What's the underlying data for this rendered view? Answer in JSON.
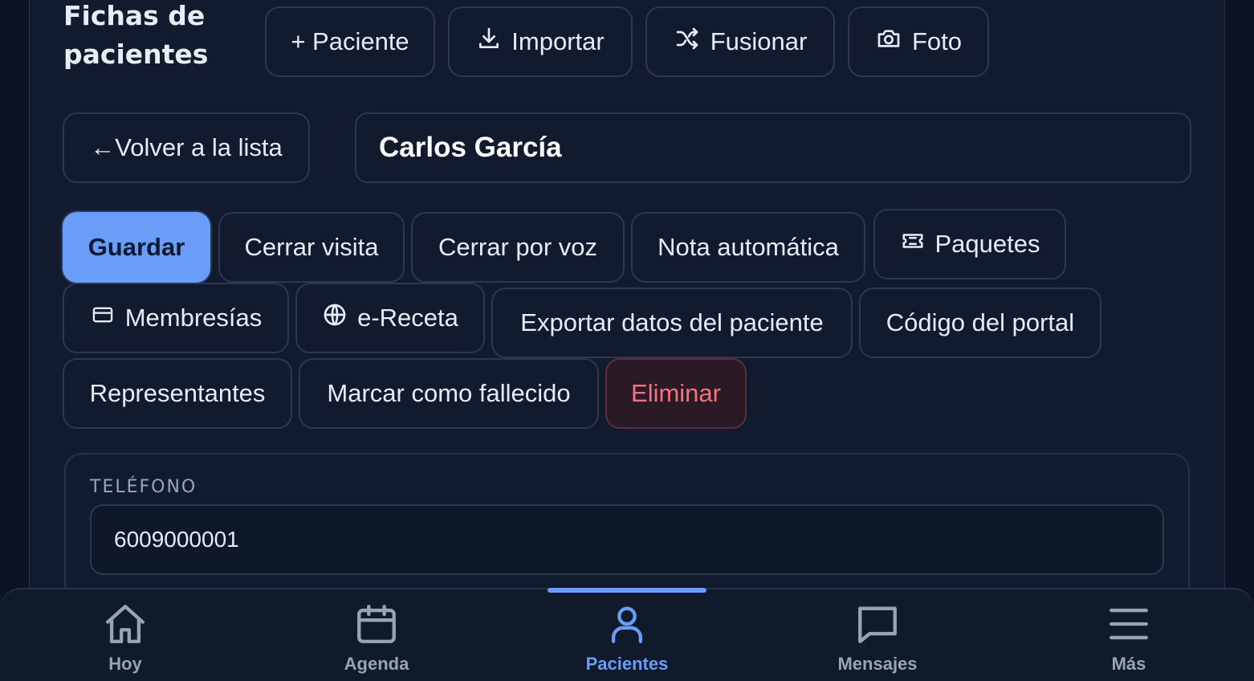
{
  "header": {
    "title": "Fichas de pacientes",
    "actions": {
      "add_patient": "+ Paciente",
      "import": "Importar",
      "merge": "Fusionar",
      "photo": "Foto"
    }
  },
  "patient": {
    "back_label": "←Volver a la lista",
    "name": "Carlos García"
  },
  "toolbar": {
    "save": "Guardar",
    "close_visit": "Cerrar visita",
    "close_voice": "Cerrar por voz",
    "auto_note": "Nota automática",
    "packages": "Paquetes",
    "memberships": "Membresías",
    "e_prescription": "e-Receta",
    "export": "Exportar datos del paciente",
    "portal_code": "Código del portal",
    "representatives": "Representantes",
    "mark_deceased": "Marcar como fallecido",
    "delete": "Eliminar"
  },
  "form": {
    "phone_label": "TELÉFONO",
    "phone_value": "6009000001"
  },
  "nav": {
    "items": [
      {
        "label": "Hoy",
        "icon": "home-icon"
      },
      {
        "label": "Agenda",
        "icon": "calendar-icon"
      },
      {
        "label": "Pacientes",
        "icon": "user-icon",
        "active": true
      },
      {
        "label": "Mensajes",
        "icon": "message-icon"
      },
      {
        "label": "Más",
        "icon": "menu-icon"
      }
    ]
  },
  "colors": {
    "accent": "#6a9df7",
    "danger": "#f07480",
    "background": "#0c1322"
  }
}
